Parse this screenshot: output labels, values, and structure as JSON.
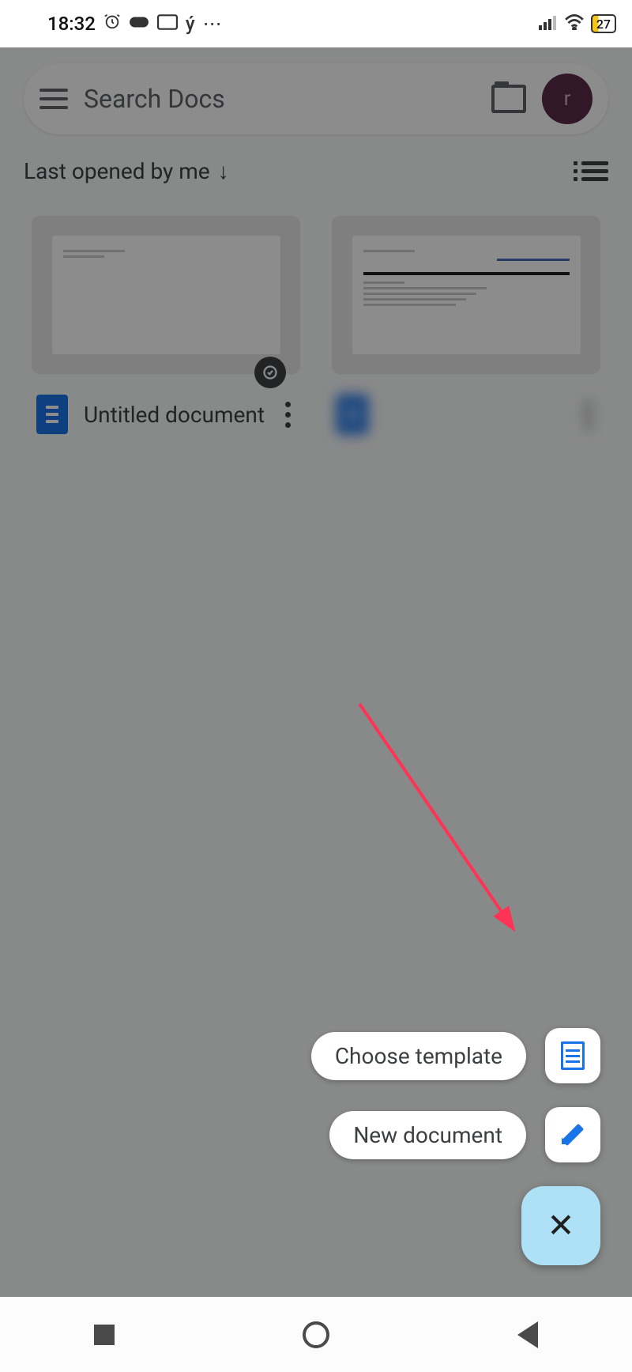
{
  "status_bar": {
    "time": "18:32",
    "battery_percent": "27",
    "icons": {
      "alarm": "⏰",
      "game": "🎮",
      "cast": "▭",
      "y": "ý",
      "more": "⋯",
      "signal": "📶",
      "wifi": "📡"
    }
  },
  "header": {
    "search_placeholder": "Search Docs",
    "avatar_letter": "r"
  },
  "sort": {
    "label": "Last opened by me",
    "direction_glyph": "↓"
  },
  "documents": [
    {
      "title": "Untitled document",
      "has_offline_badge": true
    },
    {
      "title": "",
      "has_offline_badge": false
    }
  ],
  "fab_menu": {
    "choose_template": "Choose template",
    "new_document": "New document"
  }
}
